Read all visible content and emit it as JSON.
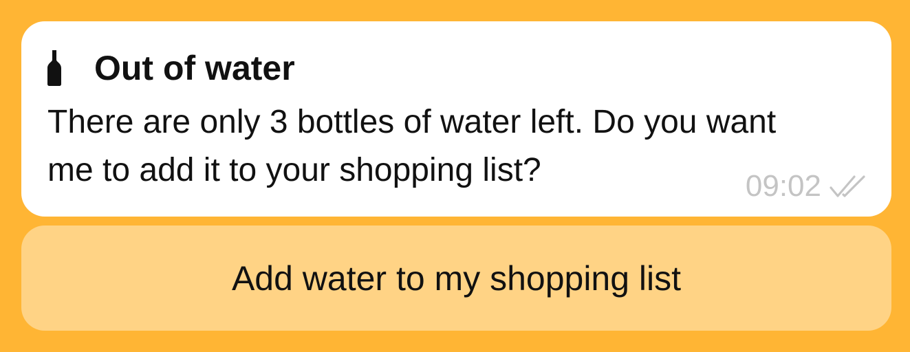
{
  "colors": {
    "background": "#FFB534",
    "card": "#FFFFFF",
    "action_button": "#FFD385",
    "text": "#111111",
    "timestamp": "#C4C4C4"
  },
  "message": {
    "icon": "bottle-icon",
    "title": "Out of water",
    "body": "There are only 3 bottles of water left. Do you want me to add it to your shopping list?",
    "time": "09:02",
    "status_icon": "double-check-icon"
  },
  "action": {
    "label": "Add water to my shopping list"
  }
}
